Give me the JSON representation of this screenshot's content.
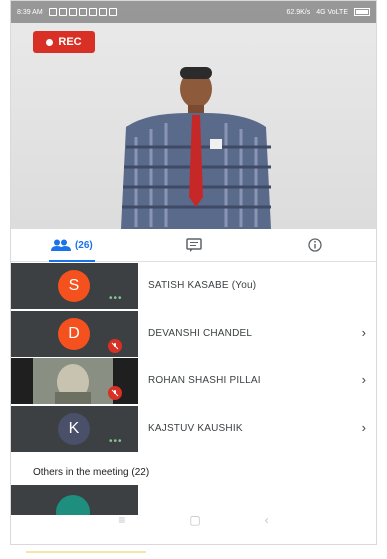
{
  "status_bar": {
    "time": "8:39 AM",
    "speed": "62.9K/s",
    "network": "4G VoLTE"
  },
  "recording": {
    "label": "REC"
  },
  "tabs": {
    "people_count": "(26)"
  },
  "participants": [
    {
      "initial": "S",
      "name": "SATISH KASABE (You)",
      "color": "#f4511e",
      "status": "speaking",
      "has_chevron": false
    },
    {
      "initial": "D",
      "name": "DEVANSHI CHANDEL",
      "color": "#f4511e",
      "status": "muted",
      "has_chevron": true
    },
    {
      "initial": "",
      "name": "ROHAN SHASHI PILLAI",
      "color": "#5f6368",
      "status": "muted",
      "has_chevron": true
    },
    {
      "initial": "K",
      "name": "KAJSTUV KAUSHIK",
      "color": "#4a4f6a",
      "status": "speaking",
      "has_chevron": true
    }
  ],
  "others_section": {
    "label": "Others in the meeting (22)"
  },
  "colors": {
    "accent": "#1a73e8",
    "rec": "#d93025"
  }
}
